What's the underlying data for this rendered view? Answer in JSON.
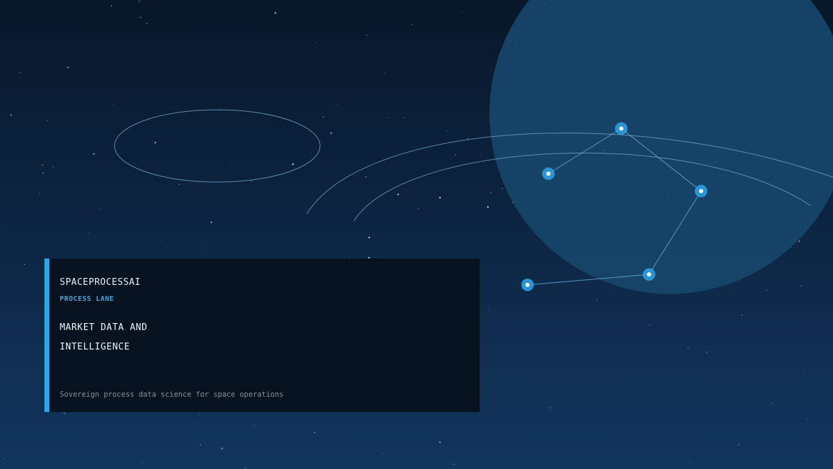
{
  "card": {
    "brand": "SPACEPROCESSAI",
    "lane": "PROCESS LANE",
    "headline_lines": [
      "MARKET DATA AND",
      "INTELLIGENCE"
    ],
    "tagline": "Sovereign process data science for space operations"
  },
  "colors": {
    "accent": "#2ea8e4",
    "planet": "#17496e",
    "node": "#2d9ee0",
    "orbit": "#7fb0d3",
    "card_bg": "#06121f"
  }
}
